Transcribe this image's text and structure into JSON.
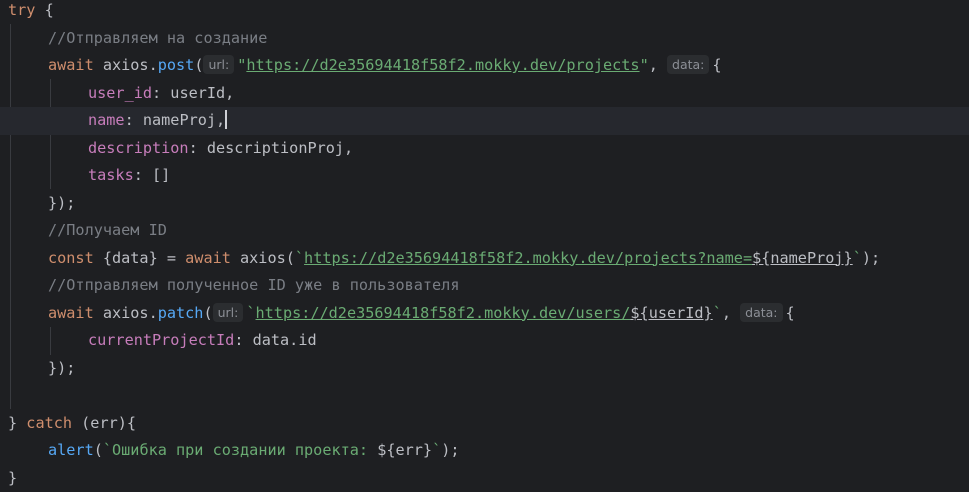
{
  "hints": {
    "url": "url:",
    "data": "data:"
  },
  "lines": {
    "l1": {
      "try": "try",
      "brace": " {"
    },
    "l2": {
      "comment": "//Отправляем на создание"
    },
    "l3": {
      "await": "await",
      "sp": " axios.",
      "fn": "post",
      "open": "(",
      "str": "\"",
      "url": "https://d2e35694418f58f2.mokky.dev/projects",
      "str2": "\"",
      "comma": ", ",
      "brace": "{"
    },
    "l4": {
      "prop": "user_id",
      "rest": ": userId,"
    },
    "l5": {
      "prop": "name",
      "rest": ": nameProj,",
      "after": ""
    },
    "l6": {
      "prop": "description",
      "rest": ": descriptionProj,"
    },
    "l7": {
      "prop": "tasks",
      "rest": ": []"
    },
    "l8": {
      "text": "});"
    },
    "l9": {
      "comment": "//Получаем ID"
    },
    "l10": {
      "const": "const",
      "mid": " {data} = ",
      "await": "await",
      "call": " axios(",
      "tick": "`",
      "url": "https://d2e35694418f58f2.mokky.dev/projects?name=",
      "interp": "${nameProj}",
      "tick2": "`",
      "end": ");"
    },
    "l11": {
      "comment": "//Отправляем полученное ID уже в пользователя"
    },
    "l12": {
      "await": "await",
      "sp": " axios.",
      "fn": "patch",
      "open": "(",
      "tick": "`",
      "url": "https://d2e35694418f58f2.mokky.dev/users/",
      "interp": "${userId}",
      "tick2": "`",
      "comma": ", ",
      "brace": "{"
    },
    "l13": {
      "prop": "currentProjectId",
      "rest": ": data.id"
    },
    "l14": {
      "text": "});"
    },
    "l16": {
      "close": "} ",
      "catch": "catch",
      "rest": " (err){"
    },
    "l17": {
      "fn": "alert",
      "open": "(",
      "str": "`Ошибка при создании проекта: ",
      "interp": "${err}",
      "str2": "`",
      "end": ");"
    },
    "l18": {
      "text": "}"
    }
  }
}
